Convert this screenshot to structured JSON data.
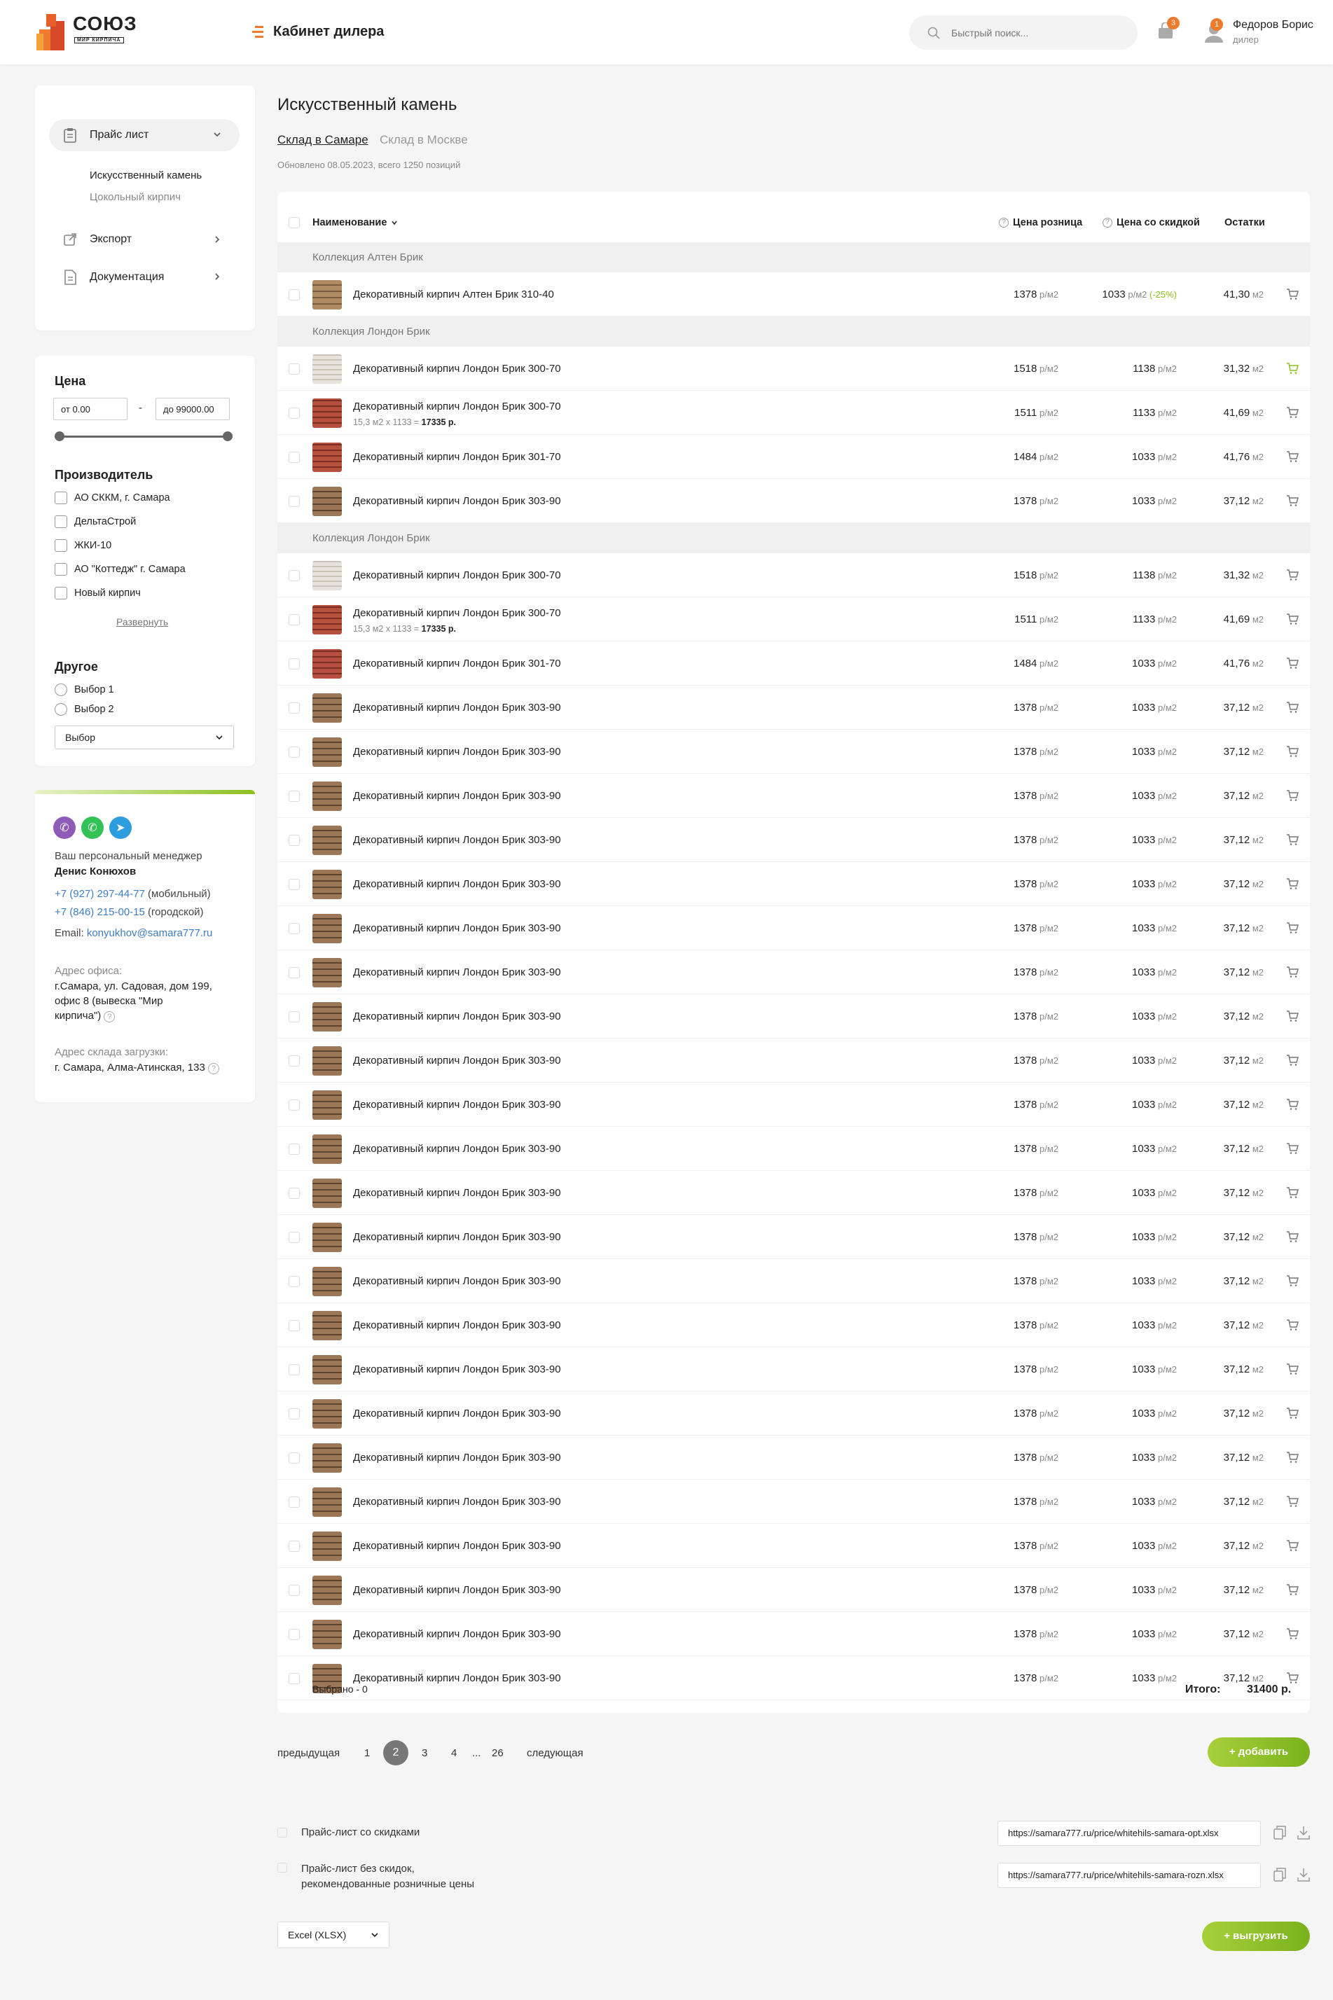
{
  "header": {
    "logo_text": "СОЮЗ",
    "logo_sub": "МИР КИРПИЧА",
    "title": "Кабинет дилера",
    "search_placeholder": "Быстрый поиск...",
    "cart_count": "3",
    "notif_count": "1",
    "user_name": "Федоров Борис",
    "user_role": "дилер",
    "accent": "#ee7a2b"
  },
  "sidebar": {
    "nav": [
      {
        "label": "Прайс лист",
        "icon": "clipboard-icon"
      },
      {
        "label": "Экспорт",
        "icon": "export-icon"
      },
      {
        "label": "Документация",
        "icon": "document-icon"
      }
    ],
    "sub_items": [
      "Искусственный камень",
      "Цокольный кирпич"
    ]
  },
  "filters": {
    "price_title": "Цена",
    "price_from": "от 0.00",
    "price_dash": "-",
    "price_to": "до 99000.00",
    "maker_title": "Производитель",
    "makers": [
      "АО СККМ, г. Самара",
      "ДельтаСтрой",
      "ЖКИ-10",
      "АО \"Коттедж\" г. Самара",
      "Новый кирпич"
    ],
    "expand": "Развернуть",
    "other_title": "Другое",
    "options": [
      "Выбор 1",
      "Выбор 2"
    ],
    "select": "Выбор"
  },
  "manager": {
    "label": "Ваш персональный менеджер",
    "name": "Денис Конюхов",
    "phone1": "+7 (927) 297-44-77",
    "phone1_note": " (мобильный)",
    "phone2": "+7 (846) 215-00-15",
    "phone2_note": " (городской)",
    "email_label": "Email: ",
    "email": "konyukhov@samara777.ru",
    "office_label": "Адрес офиса:",
    "office_l1": "г.Самара, ул. Садовая, дом 199,",
    "office_l2": "офис 8 (вывеска \"Мир",
    "office_l3": "кирпича\")",
    "warehouse_label": "Адрес склада загрузки:",
    "warehouse": "г. Самара, Алма-Атинская, 133"
  },
  "main": {
    "title": "Искусственный камень",
    "tabs": [
      "Склад в Самаре",
      "Склад в Москве"
    ],
    "updated": "Обновлено 08.05.2023, всего 1250 позиций",
    "columns": {
      "name": "Наименование",
      "retail": "Цена розница",
      "discount": "Цена со скидкой",
      "stock": "Остатки"
    },
    "unit_price": " р/м2",
    "unit_stock": " м2",
    "groups": [
      "Коллекция Алтен Брик",
      "Коллекция Лондон Брик",
      "Коллекция Лондон Брик"
    ],
    "rows": [
      {
        "name": "Декоративный кирпич Алтен Брик 310-40",
        "retail": "1378",
        "disc": "1033",
        "disc_pct": " (-25%)",
        "stock": "41,30",
        "thumb": "alt"
      },
      {
        "name": "Декоративный кирпич Лондон Брик 300-70",
        "retail": "1518",
        "disc": "1138",
        "stock": "31,32",
        "thumb": "light",
        "cart_active": true
      },
      {
        "name": "Декоративный кирпич Лондон Брик 300-70",
        "sub": "15,3 м2 х 1133 = ",
        "sub_total": "17335 р.",
        "retail": "1511",
        "disc": "1133",
        "stock": "41,69",
        "thumb": "red"
      },
      {
        "name": "Декоративный кирпич Лондон Брик 301-70",
        "retail": "1484",
        "disc": "1033",
        "stock": "41,76",
        "thumb": "red"
      },
      {
        "name": "Декоративный кирпич Лондон Брик 303-90",
        "retail": "1378",
        "disc": "1033",
        "stock": "37,12",
        "thumb": "brown"
      },
      {
        "name": "Декоративный кирпич Лондон Брик 300-70",
        "retail": "1518",
        "disc": "1138",
        "stock": "31,32",
        "thumb": "light"
      },
      {
        "name": "Декоративный кирпич Лондон Брик 300-70",
        "sub": "15,3 м2 х 1133 = ",
        "sub_total": "17335 р.",
        "retail": "1511",
        "disc": "1133",
        "stock": "41,69",
        "thumb": "red"
      },
      {
        "name": "Декоративный кирпич Лондон Брик 301-70",
        "retail": "1484",
        "disc": "1033",
        "stock": "41,76",
        "thumb": "red"
      },
      {
        "name": "Декоративный кирпич Лондон Брик 303-90",
        "retail": "1378",
        "disc": "1033",
        "stock": "37,12",
        "thumb": "brown"
      },
      {
        "name": "Декоративный кирпич Лондон Брик 303-90",
        "retail": "1378",
        "disc": "1033",
        "stock": "37,12",
        "thumb": "brown"
      },
      {
        "name": "Декоративный кирпич Лондон Брик 303-90",
        "retail": "1378",
        "disc": "1033",
        "stock": "37,12",
        "thumb": "brown"
      },
      {
        "name": "Декоративный кирпич Лондон Брик 303-90",
        "retail": "1378",
        "disc": "1033",
        "stock": "37,12",
        "thumb": "brown"
      },
      {
        "name": "Декоративный кирпич Лондон Брик 303-90",
        "retail": "1378",
        "disc": "1033",
        "stock": "37,12",
        "thumb": "brown"
      },
      {
        "name": "Декоративный кирпич Лондон Брик 303-90",
        "retail": "1378",
        "disc": "1033",
        "stock": "37,12",
        "thumb": "brown"
      },
      {
        "name": "Декоративный кирпич Лондон Брик 303-90",
        "retail": "1378",
        "disc": "1033",
        "stock": "37,12",
        "thumb": "brown"
      },
      {
        "name": "Декоративный кирпич Лондон Брик 303-90",
        "retail": "1378",
        "disc": "1033",
        "stock": "37,12",
        "thumb": "brown"
      },
      {
        "name": "Декоративный кирпич Лондон Брик 303-90",
        "retail": "1378",
        "disc": "1033",
        "stock": "37,12",
        "thumb": "brown"
      },
      {
        "name": "Декоративный кирпич Лондон Брик 303-90",
        "retail": "1378",
        "disc": "1033",
        "stock": "37,12",
        "thumb": "brown"
      },
      {
        "name": "Декоративный кирпич Лондон Брик 303-90",
        "retail": "1378",
        "disc": "1033",
        "stock": "37,12",
        "thumb": "brown"
      },
      {
        "name": "Декоративный кирпич Лондон Брик 303-90",
        "retail": "1378",
        "disc": "1033",
        "stock": "37,12",
        "thumb": "brown"
      },
      {
        "name": "Декоративный кирпич Лондон Брик 303-90",
        "retail": "1378",
        "disc": "1033",
        "stock": "37,12",
        "thumb": "brown"
      },
      {
        "name": "Декоративный кирпич Лондон Брик 303-90",
        "retail": "1378",
        "disc": "1033",
        "stock": "37,12",
        "thumb": "brown"
      },
      {
        "name": "Декоративный кирпич Лондон Брик 303-90",
        "retail": "1378",
        "disc": "1033",
        "stock": "37,12",
        "thumb": "brown"
      },
      {
        "name": "Декоративный кирпич Лондон Брик 303-90",
        "retail": "1378",
        "disc": "1033",
        "stock": "37,12",
        "thumb": "brown"
      },
      {
        "name": "Декоративный кирпич Лондон Брик 303-90",
        "retail": "1378",
        "disc": "1033",
        "stock": "37,12",
        "thumb": "brown"
      },
      {
        "name": "Декоративный кирпич Лондон Брик 303-90",
        "retail": "1378",
        "disc": "1033",
        "stock": "37,12",
        "thumb": "brown"
      },
      {
        "name": "Декоративный кирпич Лондон Брик 303-90",
        "retail": "1378",
        "disc": "1033",
        "stock": "37,12",
        "thumb": "brown"
      },
      {
        "name": "Декоративный кирпич Лондон Брик 303-90",
        "retail": "1378",
        "disc": "1033",
        "stock": "37,12",
        "thumb": "brown"
      },
      {
        "name": "Декоративный кирпич Лондон Брик 303-90",
        "retail": "1378",
        "disc": "1033",
        "stock": "37,12",
        "thumb": "brown"
      },
      {
        "name": "Декоративный кирпич Лондон Брик 303-90",
        "retail": "1378",
        "disc": "1033",
        "stock": "37,12",
        "thumb": "brown"
      },
      {
        "name": "Декоративный кирпич Лондон Брик 303-90",
        "retail": "1378",
        "disc": "1033",
        "stock": "37,12",
        "thumb": "brown"
      }
    ],
    "selected": "Выбрано - 0",
    "total_label": "Итого:",
    "total": "31400 р."
  },
  "pagination": {
    "prev": "предыдущая",
    "pages": [
      "1",
      "2",
      "3",
      "4"
    ],
    "current": "2",
    "ellipsis": "...",
    "last": "26",
    "next": "следующая",
    "add_button": "+ добавить"
  },
  "pricelists": [
    {
      "label": "Прайс-лист со скидками",
      "url": "https://samara777.ru/price/whitehils-samara-opt.xlsx"
    },
    {
      "label1": "Прайс-лист без скидок,",
      "label2": "рекомендованные розничные цены",
      "url": "https://samara777.ru/price/whitehils-samara-rozn.xlsx"
    }
  ],
  "export": {
    "format": "Excel (XLSX)",
    "button": "+ выгрузить"
  }
}
